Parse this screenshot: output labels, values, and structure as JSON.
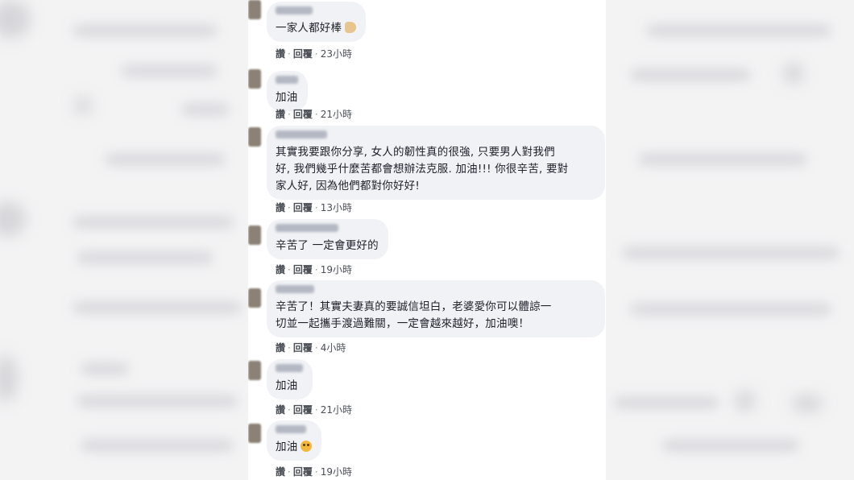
{
  "actions": {
    "like": "讚",
    "reply": "回覆",
    "separator": "·"
  },
  "comments": [
    {
      "text": "一家人都好棒",
      "emoji": "thumbs-up-icon",
      "time": "23小時"
    },
    {
      "text": "加油",
      "time": "21小時"
    },
    {
      "text": "其實我要跟你分享, 女人的韌性真的很強, 只要男人對我們\n好, 我們幾乎什麼苦都會想辦法克服. 加油!!! 你很辛苦, 要對\n家人好, 因為他們都對你好好!",
      "time": "13小時"
    },
    {
      "text": "辛苦了 一定會更好的",
      "time": "19小時"
    },
    {
      "text": "辛苦了！其實夫妻真的要誠信坦白，老婆愛你可以體諒一\n切並一起攜手渡過難關，一定會越來越好，加油噢！",
      "time": "4小時"
    },
    {
      "text": "加油",
      "time": "21小時"
    },
    {
      "text": "加油",
      "emoji": "crying-face-icon",
      "time": "19小時"
    }
  ],
  "colors": {
    "bubble": "#f1f2f6",
    "text": "#1d2129",
    "meta": "#4b4f56",
    "backdrop": "#f3f3f4"
  }
}
